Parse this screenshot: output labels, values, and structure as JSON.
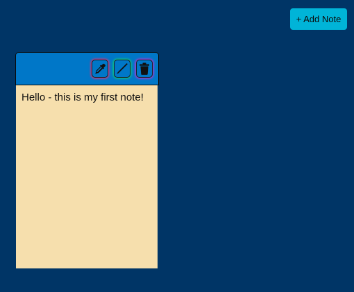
{
  "toolbar": {
    "add_note_label": "+ Add Note"
  },
  "notes": [
    {
      "text": "Hello - this is my first note!",
      "header_color": "#0077c8",
      "body_color": "#f6dfad",
      "actions": [
        {
          "icon": "eyedropper-icon",
          "role": "color"
        },
        {
          "icon": "pen-icon",
          "role": "edit"
        },
        {
          "icon": "trash-icon",
          "role": "delete"
        }
      ]
    }
  ],
  "colors": {
    "background": "#003566",
    "accent": "#00b4d8"
  }
}
